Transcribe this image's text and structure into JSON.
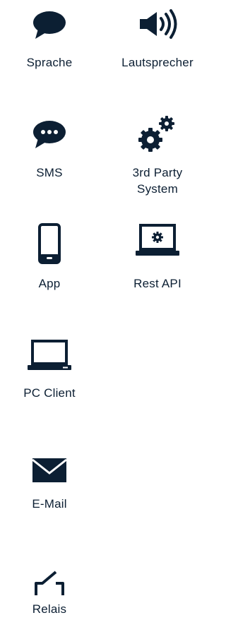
{
  "colors": {
    "icon": "#0c1f33",
    "text": "#0c1f33",
    "background": "#ffffff"
  },
  "items": [
    {
      "label": "Sprache",
      "icon": "speech-bubble-icon"
    },
    {
      "label": "Lautsprecher",
      "icon": "speaker-icon"
    },
    {
      "label": "SMS",
      "icon": "sms-bubble-icon"
    },
    {
      "label": "3rd Party\nSystem",
      "icon": "gears-icon"
    },
    {
      "label": "App",
      "icon": "smartphone-icon"
    },
    {
      "label": "Rest API",
      "icon": "laptop-gear-icon"
    },
    {
      "label": "PC Client",
      "icon": "laptop-icon"
    },
    {
      "label": "E-Mail",
      "icon": "envelope-icon"
    },
    {
      "label": "Relais",
      "icon": "relay-switch-icon"
    }
  ]
}
